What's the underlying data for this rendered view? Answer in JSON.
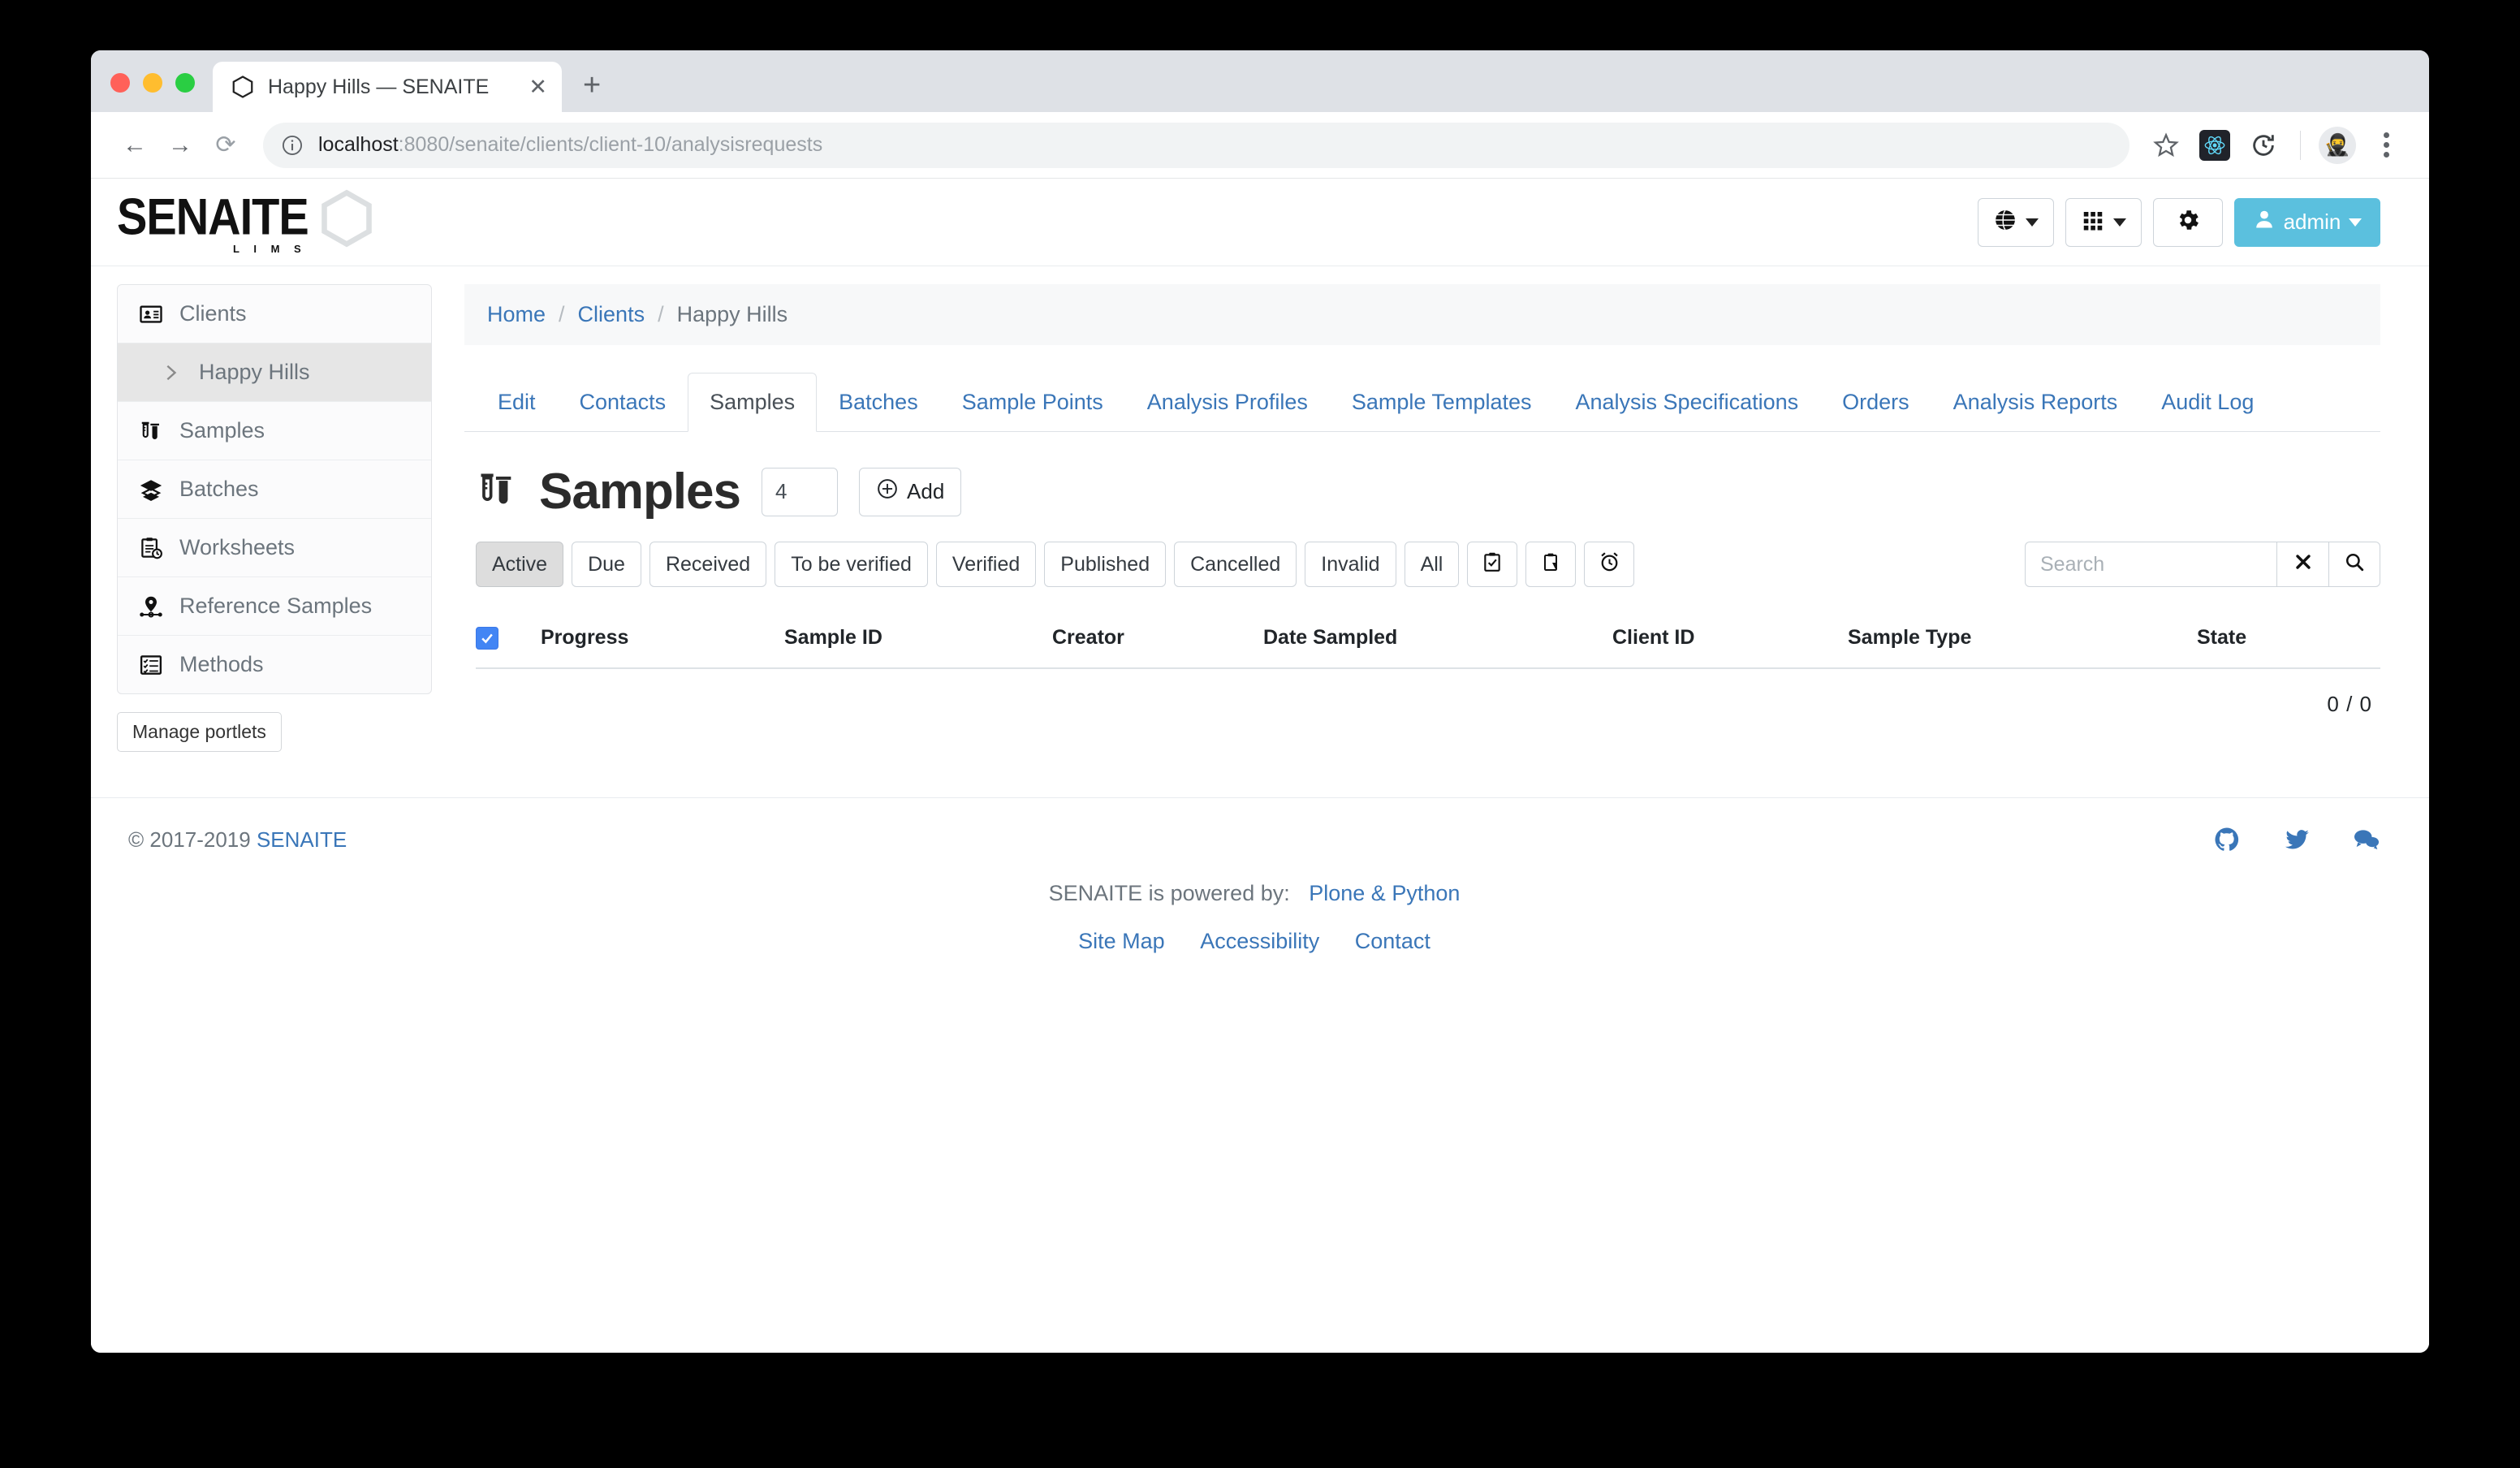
{
  "browser": {
    "tab_title": "Happy Hills — SENAITE",
    "tab_favicon_name": "hexagon-icon",
    "new_tab_label": "+",
    "close_label": "✕",
    "back_label": "←",
    "forward_label": "→",
    "reload_label": "⟳",
    "url_host": "localhost",
    "url_rest": ":8080/senaite/clients/client-10/analysisrequests",
    "bookmark_label": "☆",
    "extension_name": "react-devtools-icon",
    "history_icon_name": "history-clock-icon",
    "profile_icon_name": "profile-avatar-icon",
    "menu_icon_name": "kebab-menu-icon"
  },
  "header": {
    "logo_text": "SENAITE",
    "logo_sub": "L I M S",
    "actions": [
      {
        "name": "language-selector",
        "icon": "globe-icon",
        "label": ""
      },
      {
        "name": "apps-grid",
        "icon": "grid-icon",
        "label": ""
      },
      {
        "name": "settings",
        "icon": "gear-icon",
        "label": ""
      }
    ],
    "admin_label": "admin",
    "admin_icon": "user-icon",
    "admin_color": "#5bc0de"
  },
  "sidebar": {
    "items": [
      {
        "label": "Clients",
        "icon": "id-card-icon",
        "sub": false,
        "active": false
      },
      {
        "label": "Happy Hills",
        "icon": "chevron-right-icon",
        "sub": true,
        "active": true
      },
      {
        "label": "Samples",
        "icon": "test-tube-icon",
        "sub": false,
        "active": false
      },
      {
        "label": "Batches",
        "icon": "layers-icon",
        "sub": false,
        "active": false
      },
      {
        "label": "Worksheets",
        "icon": "clipboard-clock-icon",
        "sub": false,
        "active": false
      },
      {
        "label": "Reference Samples",
        "icon": "map-pin-icon",
        "sub": false,
        "active": false
      },
      {
        "label": "Methods",
        "icon": "checklist-icon",
        "sub": false,
        "active": false
      }
    ],
    "manage_portlets_label": "Manage portlets"
  },
  "breadcrumb": {
    "home": "Home",
    "clients": "Clients",
    "current": "Happy Hills",
    "separator": "/"
  },
  "tabs": [
    {
      "label": "Edit",
      "active": false
    },
    {
      "label": "Contacts",
      "active": false
    },
    {
      "label": "Samples",
      "active": true
    },
    {
      "label": "Batches",
      "active": false
    },
    {
      "label": "Sample Points",
      "active": false
    },
    {
      "label": "Analysis Profiles",
      "active": false
    },
    {
      "label": "Sample Templates",
      "active": false
    },
    {
      "label": "Analysis Specifications",
      "active": false
    },
    {
      "label": "Orders",
      "active": false
    },
    {
      "label": "Analysis Reports",
      "active": false
    },
    {
      "label": "Audit Log",
      "active": false
    }
  ],
  "main": {
    "title": "Samples",
    "title_icon": "test-tube-icon",
    "count_value": "4",
    "add_label": "Add",
    "add_icon": "plus-circle-icon",
    "filters": [
      {
        "label": "Active",
        "active": true,
        "icon": null
      },
      {
        "label": "Due",
        "active": false,
        "icon": null
      },
      {
        "label": "Received",
        "active": false,
        "icon": null
      },
      {
        "label": "To be verified",
        "active": false,
        "icon": null
      },
      {
        "label": "Verified",
        "active": false,
        "icon": null
      },
      {
        "label": "Published",
        "active": false,
        "icon": null
      },
      {
        "label": "Cancelled",
        "active": false,
        "icon": null
      },
      {
        "label": "Invalid",
        "active": false,
        "icon": null
      },
      {
        "label": "All",
        "active": false,
        "icon": null
      },
      {
        "label": "",
        "active": false,
        "icon": "clipboard-check-icon"
      },
      {
        "label": "",
        "active": false,
        "icon": "clipboard-icon"
      },
      {
        "label": "",
        "active": false,
        "icon": "alarm-clock-icon"
      }
    ],
    "search_placeholder": "Search",
    "search_value": "",
    "search_clear_icon": "close-icon",
    "search_go_icon": "search-icon",
    "table": {
      "select_all_checked": true,
      "columns": [
        "Progress",
        "Sample ID",
        "Creator",
        "Date Sampled",
        "Client ID",
        "Sample Type",
        "State"
      ],
      "rows": [],
      "count_text": "0 / 0"
    }
  },
  "footer": {
    "copyright": "© 2017-2019",
    "copyright_link": "SENAITE",
    "social": [
      {
        "name": "github-icon"
      },
      {
        "name": "twitter-icon"
      },
      {
        "name": "comments-icon"
      }
    ],
    "powered_by_text": "SENAITE is powered by:",
    "powered_by_link": "Plone & Python",
    "links": [
      "Site Map",
      "Accessibility",
      "Contact"
    ]
  }
}
